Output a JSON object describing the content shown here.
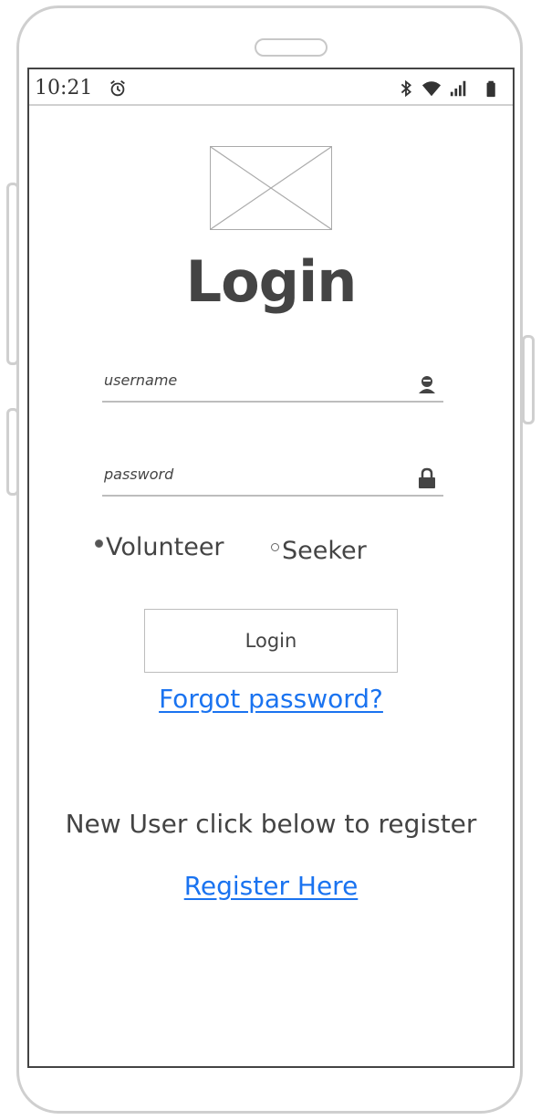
{
  "status_bar": {
    "time": "10:21",
    "icons": [
      "alarm-icon",
      "bluetooth-icon",
      "wifi-icon",
      "signal-icon",
      "battery-icon"
    ]
  },
  "login_screen": {
    "title": "Login",
    "username": {
      "placeholder": "username",
      "icon": "user-icon"
    },
    "password": {
      "placeholder": "password",
      "icon": "lock-icon"
    },
    "role_options": [
      {
        "label": "Volunteer",
        "selected": true
      },
      {
        "label": "Seeker",
        "selected": false
      }
    ],
    "login_button_label": "Login",
    "forgot_password_link": "Forgot password?",
    "register_prompt": "New User click below to register",
    "register_link": "Register Here"
  },
  "colors": {
    "link": "#1a73f0",
    "text": "#444444",
    "frame": "#cfcfcf"
  }
}
